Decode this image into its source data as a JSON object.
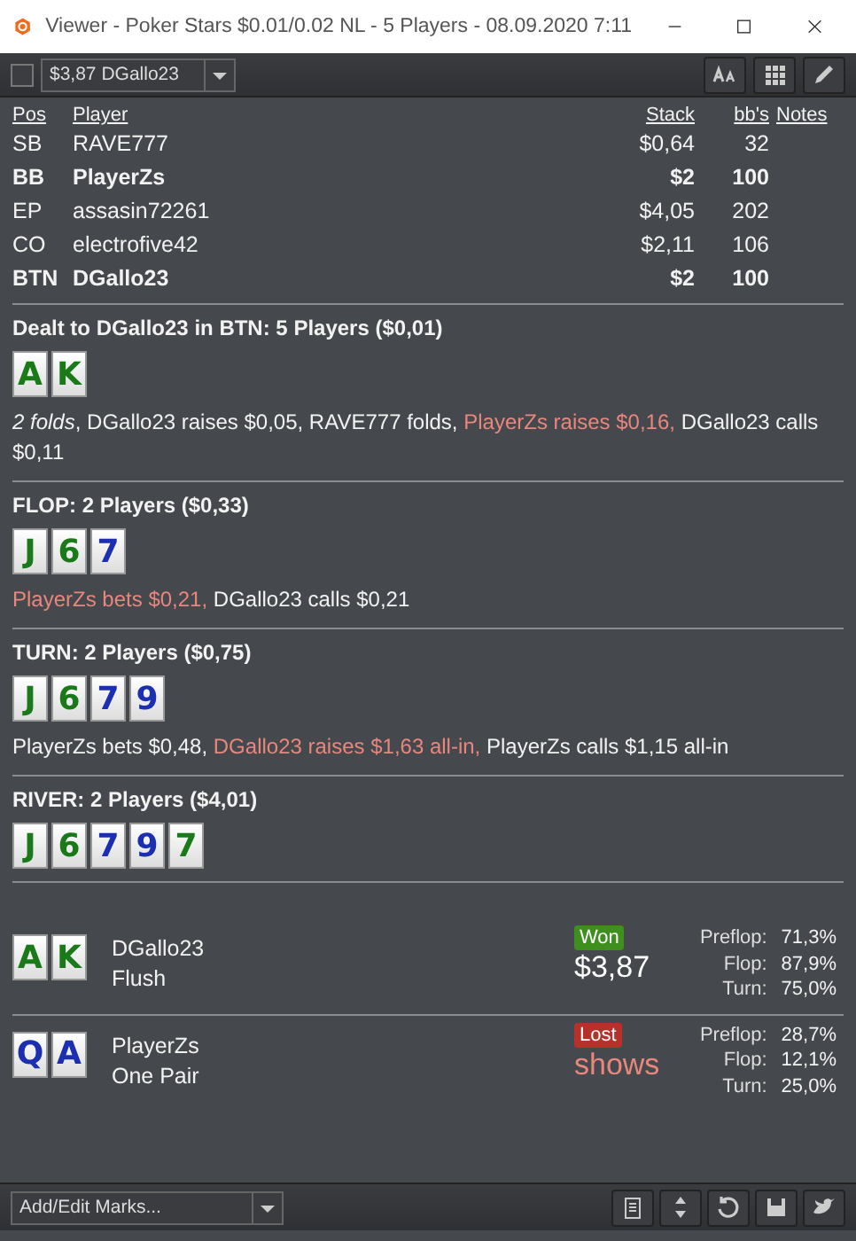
{
  "window": {
    "title": "Viewer - Poker Stars $0.01/0.02 NL - 5 Players - 08.09.2020 7:11"
  },
  "toolbar": {
    "checked": false,
    "hand_select": "$3,87 DGallo23"
  },
  "players": {
    "columns": [
      "Pos",
      "Player",
      "Stack",
      "bb's",
      "Notes"
    ],
    "rows": [
      {
        "pos": "SB",
        "player": "RAVE777",
        "stack": "$0,64",
        "bbs": "32",
        "hero": false
      },
      {
        "pos": "BB",
        "player": "PlayerZs",
        "stack": "$2",
        "bbs": "100",
        "hero": true
      },
      {
        "pos": "EP",
        "player": "assasin72261",
        "stack": "$4,05",
        "bbs": "202",
        "hero": false
      },
      {
        "pos": "CO",
        "player": "electrofive42",
        "stack": "$2,11",
        "bbs": "106",
        "hero": false
      },
      {
        "pos": "BTN",
        "player": "DGallo23",
        "stack": "$2",
        "bbs": "100",
        "hero": true
      }
    ]
  },
  "streets": [
    {
      "heading": "Dealt to DGallo23 in BTN: 5 Players ($0,01)",
      "cards": [
        {
          "rank": "A",
          "color": "#1a7a1a"
        },
        {
          "rank": "K",
          "color": "#1a7a1a"
        }
      ],
      "actions": [
        {
          "text": "2 folds",
          "kind": "italic"
        },
        {
          "text": ", DGallo23 raises $0,05, RAVE777 folds, ",
          "kind": "normal"
        },
        {
          "text": "PlayerZs raises $0,16,",
          "kind": "highlight"
        },
        {
          "text": " DGallo23 calls $0,11",
          "kind": "normal"
        }
      ]
    },
    {
      "heading": "FLOP: 2 Players ($0,33)",
      "cards": [
        {
          "rank": "J",
          "color": "#1a7a1a"
        },
        {
          "rank": "6",
          "color": "#1a7a1a"
        },
        {
          "rank": "7",
          "color": "#1b2fb0"
        }
      ],
      "actions": [
        {
          "text": "PlayerZs bets $0,21,",
          "kind": "highlight"
        },
        {
          "text": " DGallo23 calls $0,21",
          "kind": "normal"
        }
      ]
    },
    {
      "heading": "TURN: 2 Players ($0,75)",
      "cards": [
        {
          "rank": "J",
          "color": "#1a7a1a"
        },
        {
          "rank": "6",
          "color": "#1a7a1a"
        },
        {
          "rank": "7",
          "color": "#1b2fb0"
        },
        {
          "rank": "9",
          "color": "#1b2fb0"
        }
      ],
      "actions": [
        {
          "text": "PlayerZs bets $0,48, ",
          "kind": "normal"
        },
        {
          "text": "DGallo23 raises $1,63 all-in,",
          "kind": "highlight"
        },
        {
          "text": " PlayerZs calls $1,15 all-in",
          "kind": "normal"
        }
      ]
    },
    {
      "heading": "RIVER: 2 Players ($4,01)",
      "cards": [
        {
          "rank": "J",
          "color": "#1a7a1a"
        },
        {
          "rank": "6",
          "color": "#1a7a1a"
        },
        {
          "rank": "7",
          "color": "#1b2fb0"
        },
        {
          "rank": "9",
          "color": "#1b2fb0"
        },
        {
          "rank": "7",
          "color": "#1a7a1a"
        }
      ]
    }
  ],
  "results": [
    {
      "cards": [
        {
          "rank": "A",
          "color": "#1a7a1a"
        },
        {
          "rank": "K",
          "color": "#1a7a1a"
        }
      ],
      "name": "DGallo23",
      "hand": "Flush",
      "status": "Won",
      "won": true,
      "amount": "$3,87",
      "equity": [
        {
          "label": "Preflop:",
          "value": "71,3%"
        },
        {
          "label": "Flop:",
          "value": "87,9%"
        },
        {
          "label": "Turn:",
          "value": "75,0%"
        }
      ]
    },
    {
      "cards": [
        {
          "rank": "Q",
          "color": "#1b2fb0"
        },
        {
          "rank": "A",
          "color": "#1b2fb0"
        }
      ],
      "name": "PlayerZs",
      "hand": "One Pair",
      "status": "Lost",
      "won": false,
      "amount": "shows",
      "equity": [
        {
          "label": "Preflop:",
          "value": "28,7%"
        },
        {
          "label": "Flop:",
          "value": "12,1%"
        },
        {
          "label": "Turn:",
          "value": "25,0%"
        }
      ]
    }
  ],
  "footer": {
    "marks_select": "Add/Edit Marks..."
  }
}
